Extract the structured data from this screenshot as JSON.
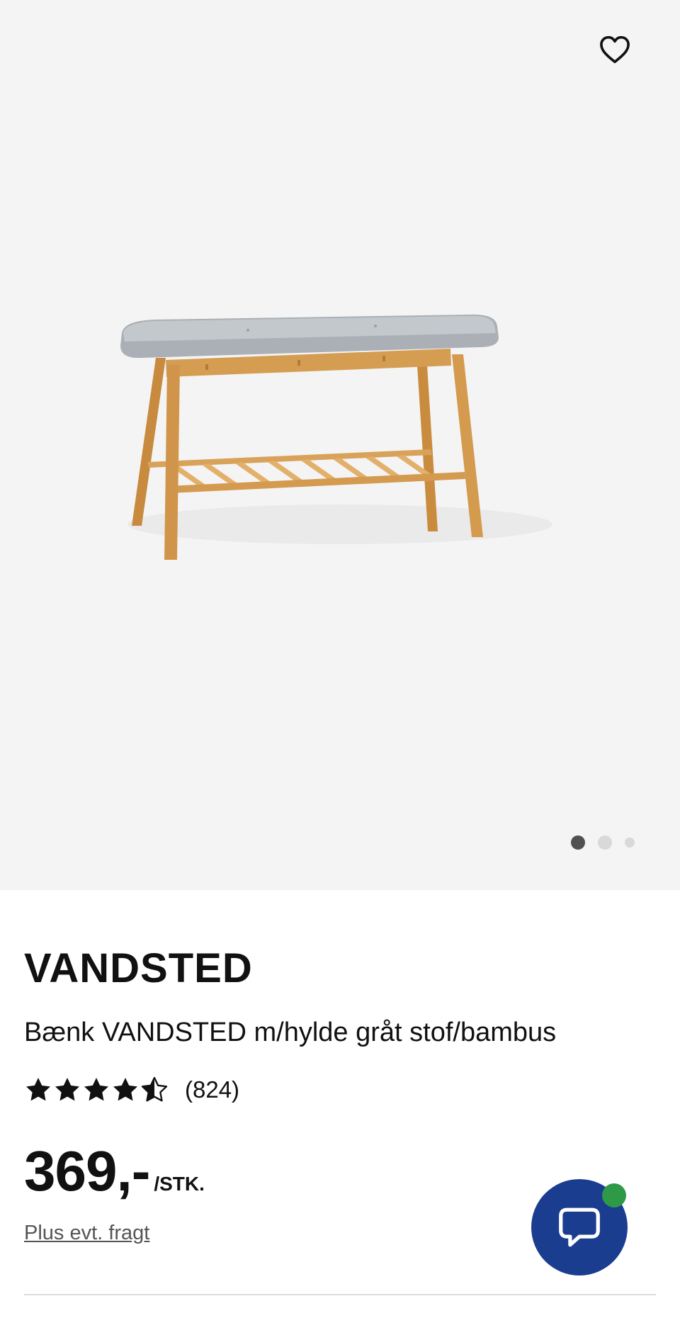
{
  "hero": {
    "favorite_icon": "heart-outline-icon",
    "image_alt": "product-photo-bench",
    "carousel": {
      "total_slides": 3,
      "active_slide": 1
    }
  },
  "product": {
    "brand": "VANDSTED",
    "description": "Bænk VANDSTED m/hylde gråt stof/bambus",
    "rating": {
      "stars": 4.5,
      "max_stars": 5,
      "count": "(824)"
    },
    "price": "369,-",
    "unit": "/STK.",
    "shipping_link": "Plus evt. fragt"
  },
  "chat": {
    "icon": "chat-bubble-icon",
    "status": "online",
    "status_color": "#2e9a48",
    "button_color": "#1a3d8f"
  }
}
